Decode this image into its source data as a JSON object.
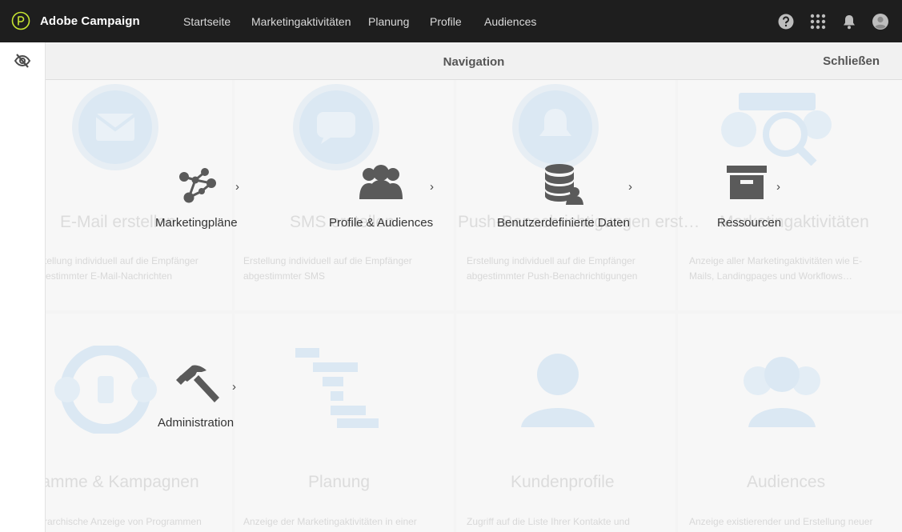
{
  "app": {
    "name": "Adobe Campaign",
    "colors": {
      "topbar": "#1e1e1e",
      "accent": "#c8e632",
      "faded_illustration": "#dbe8f3"
    }
  },
  "topnav": {
    "items": [
      {
        "label": "Startseite"
      },
      {
        "label": "Marketingaktivitäten"
      },
      {
        "label": "Planung"
      },
      {
        "label": "Profile"
      },
      {
        "label": "Audiences"
      }
    ],
    "icons": [
      "help-icon",
      "apps-grid-icon",
      "notification-bell-icon",
      "user-avatar-icon"
    ]
  },
  "panel": {
    "title": "Navigation",
    "close_label": "Schließen",
    "rail_icon": "hide-eye-icon"
  },
  "nav_tiles": [
    {
      "label": "Marketingpläne",
      "icon": "network-nodes-icon"
    },
    {
      "label": "Profile & Audiences",
      "icon": "people-group-icon"
    },
    {
      "label": "Benutzerdefinierte Daten",
      "icon": "database-user-icon"
    },
    {
      "label": "Ressourcen",
      "icon": "archive-box-icon"
    },
    {
      "label": "Administration",
      "icon": "hammer-icon"
    }
  ],
  "background_cards": [
    {
      "title": "E-Mail erstellen",
      "desc": "Erstellung individuell auf die Empfänger abgestimmter E-Mail-Nachrichten"
    },
    {
      "title": "SMS erstellen",
      "desc": "Erstellung individuell auf die Empfänger abgestimmter SMS"
    },
    {
      "title": "Push-Benachrichtigungen erst…",
      "desc": "Erstellung individuell auf die Empfänger abgestimmter Push-Benachrichtigungen"
    },
    {
      "title": "Marketingaktivitäten",
      "desc": "Anzeige aller Marketingaktivitäten wie E-Mails, Landingpages und Workflows…"
    },
    {
      "title": "Programme & Kampagnen",
      "desc": "Hierarchische Anzeige von Programmen"
    },
    {
      "title": "Planung",
      "desc": "Anzeige der Marketingaktivitäten in einer"
    },
    {
      "title": "Kundenprofile",
      "desc": "Zugriff auf die Liste Ihrer Kontakte und"
    },
    {
      "title": "Audiences",
      "desc": "Anzeige existierender und Erstellung neuer"
    }
  ]
}
